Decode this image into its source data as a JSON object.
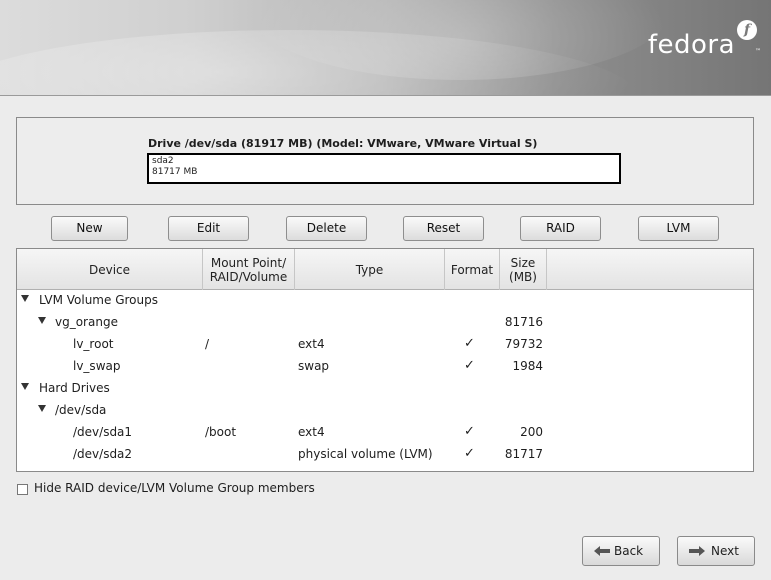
{
  "header": {
    "logo_text": "fedora",
    "logo_mark": "f",
    "logo_tm": "™"
  },
  "drive": {
    "title": "Drive /dev/sda (81917 MB) (Model: VMware, VMware Virtual S)",
    "partition_name": "sda2",
    "partition_size": "81717 MB"
  },
  "toolbar": {
    "new_label": "New",
    "edit_label": "Edit",
    "delete_label": "Delete",
    "reset_label": "Reset",
    "raid_label": "RAID",
    "lvm_label": "LVM"
  },
  "table": {
    "columns": {
      "device": "Device",
      "mount_1": "Mount Point/",
      "mount_2": "RAID/Volume",
      "type": "Type",
      "format": "Format",
      "size_1": "Size",
      "size_2": "(MB)"
    },
    "rows": [
      {
        "device": "LVM Volume Groups",
        "mount": "",
        "type": "",
        "format": "",
        "size": ""
      },
      {
        "device": "vg_orange",
        "mount": "",
        "type": "",
        "format": "",
        "size": "81716"
      },
      {
        "device": "lv_root",
        "mount": "/",
        "type": "ext4",
        "format": "✓",
        "size": "79732"
      },
      {
        "device": "lv_swap",
        "mount": "",
        "type": "swap",
        "format": "✓",
        "size": "1984"
      },
      {
        "device": "Hard Drives",
        "mount": "",
        "type": "",
        "format": "",
        "size": ""
      },
      {
        "device": "/dev/sda",
        "mount": "",
        "type": "",
        "format": "",
        "size": ""
      },
      {
        "device": "/dev/sda1",
        "mount": "/boot",
        "type": "ext4",
        "format": "✓",
        "size": "200"
      },
      {
        "device": "/dev/sda2",
        "mount": "",
        "type": "physical volume (LVM)",
        "format": "✓",
        "size": "81717"
      }
    ]
  },
  "hide_option": {
    "label": "Hide RAID device/LVM Volume Group members",
    "checked": false
  },
  "nav": {
    "back_label": "Back",
    "next_label": "Next"
  },
  "colors": {
    "header_light": "#dcdcdc",
    "header_dark": "#757575",
    "background": "#ececec"
  }
}
